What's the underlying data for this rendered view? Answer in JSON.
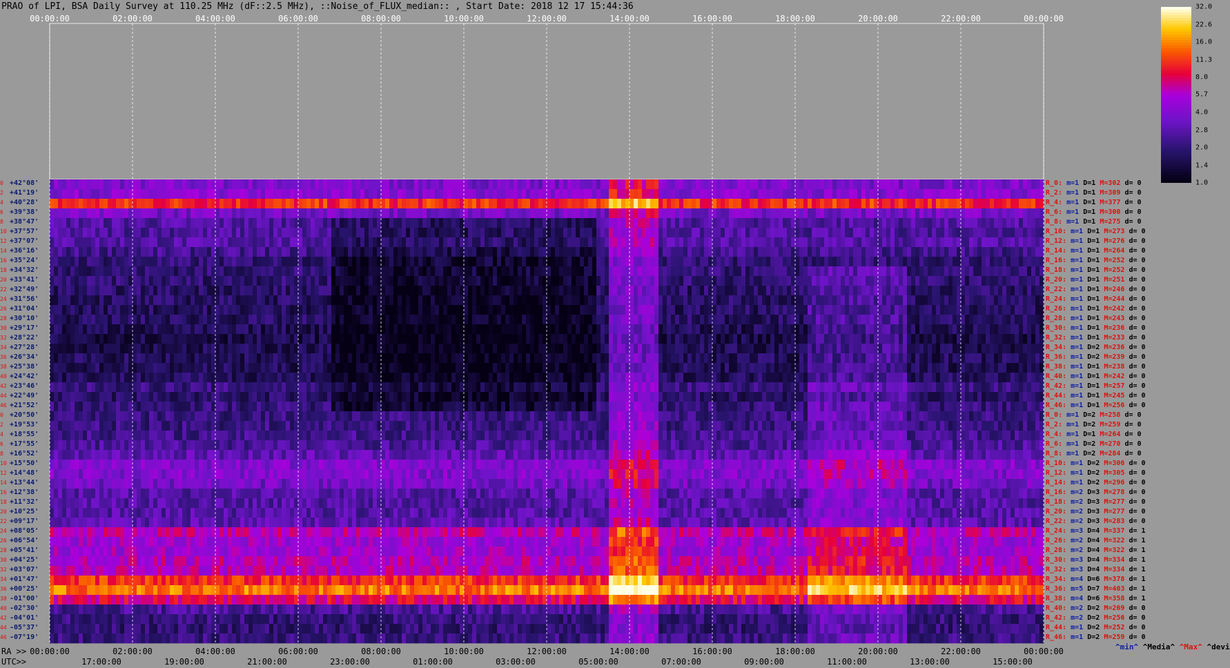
{
  "title": "PRAO of LPI, BSA Daily Survey at 110.25 MHz (dF::2.5 MHz), ::Noise_of_FLUX_median:: , Start Date: 2018 12 17 15:44:36",
  "chart_data": {
    "type": "heatmap",
    "x_top_ticks": [
      "00:00:00",
      "02:00:00",
      "04:00:00",
      "06:00:00",
      "08:00:00",
      "10:00:00",
      "12:00:00",
      "14:00:00",
      "16:00:00",
      "18:00:00",
      "20:00:00",
      "22:00:00",
      "00:00:00"
    ],
    "ra_ticks": [
      "00:00:00",
      "02:00:00",
      "04:00:00",
      "06:00:00",
      "08:00:00",
      "10:00:00",
      "12:00:00",
      "14:00:00",
      "16:00:00",
      "18:00:00",
      "20:00:00",
      "22:00:00",
      "00:00:00"
    ],
    "utc_ticks": [
      "17:00:00",
      "19:00:00",
      "21:00:00",
      "23:00:00",
      "01:00:00",
      "03:00:00",
      "05:00:00",
      "07:00:00",
      "09:00:00",
      "11:00:00",
      "13:00:00",
      "15:00:00"
    ],
    "ra_axis_label": "RA >>",
    "utc_axis_label": "UTC>>",
    "colorbar_ticks": [
      "32.0",
      "22.6",
      "16.0",
      "11.3",
      "8.0",
      "5.7",
      "4.0",
      "2.8",
      "2.0",
      "1.4",
      "1.0"
    ],
    "colorbar_range": [
      1.0,
      32.0
    ],
    "colorbar_scale": "log",
    "rows": [
      {
        "dec": "+42°08'",
        "r": "R_0:",
        "m": "1",
        "D": "1",
        "M": "302",
        "d": "0"
      },
      {
        "dec": "+41°19'",
        "r": "R_2:",
        "m": "1",
        "D": "1",
        "M": "309",
        "d": "0"
      },
      {
        "dec": "+40°28'",
        "r": "R_4:",
        "m": "1",
        "D": "1",
        "M": "377",
        "d": "0"
      },
      {
        "dec": "+39°38'",
        "r": "R_6:",
        "m": "1",
        "D": "1",
        "M": "300",
        "d": "0"
      },
      {
        "dec": "+38°47'",
        "r": "R_8:",
        "m": "1",
        "D": "1",
        "M": "275",
        "d": "0"
      },
      {
        "dec": "+37°57'",
        "r": "R_10:",
        "m": "1",
        "D": "1",
        "M": "273",
        "d": "0"
      },
      {
        "dec": "+37°07'",
        "r": "R_12:",
        "m": "1",
        "D": "1",
        "M": "276",
        "d": "0"
      },
      {
        "dec": "+36°16'",
        "r": "R_14:",
        "m": "1",
        "D": "1",
        "M": "264",
        "d": "0"
      },
      {
        "dec": "+35°24'",
        "r": "R_16:",
        "m": "1",
        "D": "1",
        "M": "252",
        "d": "0"
      },
      {
        "dec": "+34°32'",
        "r": "R_18:",
        "m": "1",
        "D": "1",
        "M": "252",
        "d": "0"
      },
      {
        "dec": "+33°41'",
        "r": "R_20:",
        "m": "1",
        "D": "1",
        "M": "251",
        "d": "0"
      },
      {
        "dec": "+32°49'",
        "r": "R_22:",
        "m": "1",
        "D": "1",
        "M": "246",
        "d": "0"
      },
      {
        "dec": "+31°56'",
        "r": "R_24:",
        "m": "1",
        "D": "1",
        "M": "244",
        "d": "0"
      },
      {
        "dec": "+31°04'",
        "r": "R_26:",
        "m": "1",
        "D": "1",
        "M": "242",
        "d": "0"
      },
      {
        "dec": "+30°10'",
        "r": "R_28:",
        "m": "1",
        "D": "1",
        "M": "243",
        "d": "0"
      },
      {
        "dec": "+29°17'",
        "r": "R_30:",
        "m": "1",
        "D": "1",
        "M": "236",
        "d": "0"
      },
      {
        "dec": "+28°22'",
        "r": "R_32:",
        "m": "1",
        "D": "1",
        "M": "233",
        "d": "0"
      },
      {
        "dec": "+27°28'",
        "r": "R_34:",
        "m": "1",
        "D": "2",
        "M": "236",
        "d": "0"
      },
      {
        "dec": "+26°34'",
        "r": "R_36:",
        "m": "1",
        "D": "2",
        "M": "239",
        "d": "0"
      },
      {
        "dec": "+25°38'",
        "r": "R_38:",
        "m": "1",
        "D": "1",
        "M": "238",
        "d": "0"
      },
      {
        "dec": "+24°42'",
        "r": "R_40:",
        "m": "1",
        "D": "1",
        "M": "242",
        "d": "0"
      },
      {
        "dec": "+23°46'",
        "r": "R_42:",
        "m": "1",
        "D": "1",
        "M": "257",
        "d": "0"
      },
      {
        "dec": "+22°49'",
        "r": "R_44:",
        "m": "1",
        "D": "1",
        "M": "245",
        "d": "0"
      },
      {
        "dec": "+21°52'",
        "r": "R_46:",
        "m": "1",
        "D": "1",
        "M": "256",
        "d": "0"
      },
      {
        "dec": "+20°50'",
        "r": "R_0:",
        "m": "1",
        "D": "2",
        "M": "258",
        "d": "0"
      },
      {
        "dec": "+19°53'",
        "r": "R_2:",
        "m": "1",
        "D": "2",
        "M": "259",
        "d": "0"
      },
      {
        "dec": "+18°55'",
        "r": "R_4:",
        "m": "1",
        "D": "1",
        "M": "264",
        "d": "0"
      },
      {
        "dec": "+17°55'",
        "r": "R_6:",
        "m": "1",
        "D": "2",
        "M": "270",
        "d": "0"
      },
      {
        "dec": "+16°52'",
        "r": "R_8:",
        "m": "1",
        "D": "2",
        "M": "284",
        "d": "0"
      },
      {
        "dec": "+15°50'",
        "r": "R_10:",
        "m": "1",
        "D": "2",
        "M": "306",
        "d": "0"
      },
      {
        "dec": "+14°48'",
        "r": "R_12:",
        "m": "1",
        "D": "2",
        "M": "305",
        "d": "0"
      },
      {
        "dec": "+13°44'",
        "r": "R_14:",
        "m": "1",
        "D": "2",
        "M": "296",
        "d": "0"
      },
      {
        "dec": "+12°38'",
        "r": "R_16:",
        "m": "2",
        "D": "3",
        "M": "278",
        "d": "0"
      },
      {
        "dec": "+11°32'",
        "r": "R_18:",
        "m": "2",
        "D": "3",
        "M": "277",
        "d": "0"
      },
      {
        "dec": "+10°25'",
        "r": "R_20:",
        "m": "2",
        "D": "3",
        "M": "277",
        "d": "0"
      },
      {
        "dec": "+09°17'",
        "r": "R_22:",
        "m": "2",
        "D": "3",
        "M": "283",
        "d": "0"
      },
      {
        "dec": "+08°05'",
        "r": "R_24:",
        "m": "3",
        "D": "4",
        "M": "337",
        "d": "1"
      },
      {
        "dec": "+06°54'",
        "r": "R_26:",
        "m": "2",
        "D": "4",
        "M": "322",
        "d": "1"
      },
      {
        "dec": "+05°41'",
        "r": "R_28:",
        "m": "2",
        "D": "4",
        "M": "322",
        "d": "1"
      },
      {
        "dec": "+04°25'",
        "r": "R_30:",
        "m": "3",
        "D": "4",
        "M": "334",
        "d": "1"
      },
      {
        "dec": "+03°07'",
        "r": "R_32:",
        "m": "3",
        "D": "4",
        "M": "334",
        "d": "1"
      },
      {
        "dec": "+01°47'",
        "r": "R_34:",
        "m": "4",
        "D": "6",
        "M": "378",
        "d": "1"
      },
      {
        "dec": "+00°25'",
        "r": "R_36:",
        "m": "5",
        "D": "7",
        "M": "403",
        "d": "1"
      },
      {
        "dec": "-01°00'",
        "r": "R_38:",
        "m": "4",
        "D": "6",
        "M": "358",
        "d": "1"
      },
      {
        "dec": "-02°30'",
        "r": "R_40:",
        "m": "2",
        "D": "2",
        "M": "269",
        "d": "0"
      },
      {
        "dec": "-04°01'",
        "r": "R_42:",
        "m": "2",
        "D": "2",
        "M": "256",
        "d": "0"
      },
      {
        "dec": "-05°37'",
        "r": "R_44:",
        "m": "1",
        "D": "2",
        "M": "252",
        "d": "0"
      },
      {
        "dec": "-07°19'",
        "r": "R_46:",
        "m": "1",
        "D": "2",
        "M": "259",
        "d": "0"
      }
    ],
    "stat_legend": {
      "min": "^min^",
      "median": "^Media^",
      "max": "^Max^",
      "dev": "^devia^"
    },
    "row_indices": [
      "0",
      "2",
      "4",
      "6",
      "8",
      "10",
      "12",
      "14",
      "16",
      "18",
      "20",
      "22",
      "24",
      "26",
      "28",
      "30",
      "32",
      "34",
      "36",
      "38",
      "40",
      "42",
      "44",
      "46",
      "0",
      "2",
      "4",
      "6",
      "8",
      "10",
      "12",
      "14",
      "16",
      "18",
      "20",
      "22",
      "24",
      "26",
      "28",
      "30",
      "32",
      "34",
      "36",
      "38",
      "40",
      "42",
      "44",
      "46"
    ]
  }
}
